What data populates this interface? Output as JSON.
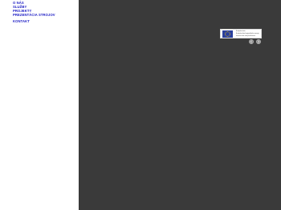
{
  "nav": {
    "items": [
      {
        "label": "O NÁS"
      },
      {
        "label": "SLUŽBY"
      },
      {
        "label": "PROJEKTY"
      },
      {
        "label": "PREZENTÁCIA STROJOV"
      },
      {
        "label": "KONTAKT"
      }
    ]
  },
  "banner": {
    "line1": "Európska únia",
    "line2": "Európsky fond regionálneho rozvoja",
    "line3": "Investícia do vašej budúcnosti"
  },
  "slideshow": {
    "prev_icon": "chevron-left-icon",
    "next_icon": "chevron-right-icon"
  },
  "colors": {
    "nav_link": "#1b1bc4",
    "stage_bg": "#3a3a3a",
    "eu_blue": "#2a3f9d",
    "eu_gold": "#ffcc00"
  }
}
